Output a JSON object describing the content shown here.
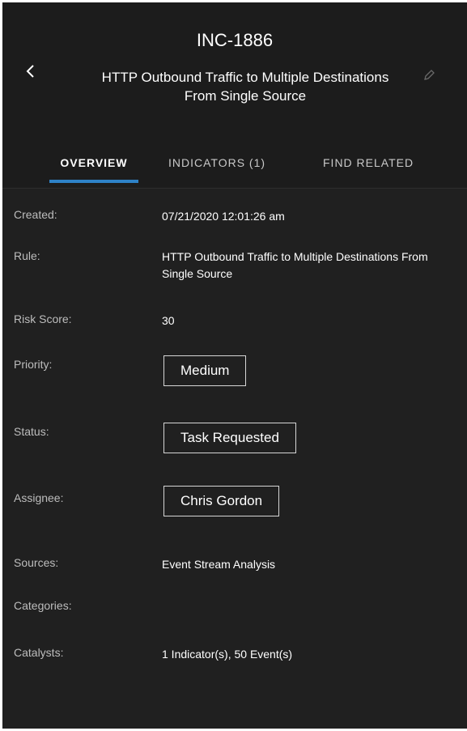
{
  "header": {
    "incident_id": "INC-1886",
    "title": "HTTP Outbound Traffic to Multiple Destinations From Single Source",
    "back_icon": "chevron-left-icon",
    "edit_icon": "pencil-icon"
  },
  "tabs": [
    {
      "label": "OVERVIEW",
      "active": true
    },
    {
      "label": "INDICATORS (1)",
      "active": false
    },
    {
      "label": "FIND RELATED",
      "active": false
    }
  ],
  "colors": {
    "background": "#1c1c1c",
    "content_background": "#202020",
    "accent": "#2e82c7"
  },
  "fields": {
    "created": {
      "label": "Created:",
      "value": "07/21/2020 12:01:26 am"
    },
    "rule": {
      "label": "Rule:",
      "value": "HTTP Outbound Traffic to Multiple Destinations From Single Source"
    },
    "risk_score": {
      "label": "Risk Score:",
      "value": "30"
    },
    "priority": {
      "label": "Priority:",
      "value": "Medium"
    },
    "status": {
      "label": "Status:",
      "value": "Task Requested"
    },
    "assignee": {
      "label": "Assignee:",
      "value": "Chris Gordon"
    },
    "sources": {
      "label": "Sources:",
      "value": "Event Stream Analysis"
    },
    "categories": {
      "label": "Categories:",
      "value": ""
    },
    "catalysts": {
      "label": "Catalysts:",
      "value": "1 Indicator(s), 50 Event(s)"
    }
  }
}
